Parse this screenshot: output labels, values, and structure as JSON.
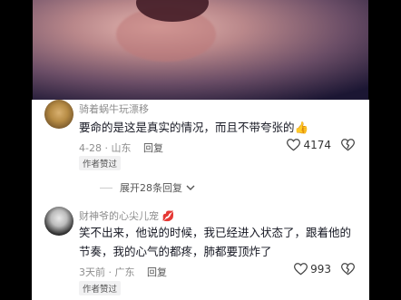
{
  "comments": [
    {
      "username": "骑着蜗牛玩漂移",
      "text": "要命的是这是真实的情况，而且不带夸张的",
      "emoji": "👍",
      "meta": "4-28 · 山东",
      "reply_label": "回复",
      "likes": "4174",
      "badge": "作者赞过"
    },
    {
      "username": "财神爷的心尖儿宠",
      "username_emoji": "💋",
      "text": "笑不出来，他说的时候，我已经进入状态了，跟着他的节奏，我的心气的都疼，肺都要顶炸了",
      "meta": "3天前 · 广东",
      "reply_label": "回复",
      "likes": "993",
      "badge": "作者赞过"
    }
  ],
  "expand_replies": "展开28条回复",
  "icons": {
    "like": "heart-outline-icon",
    "dislike": "broken-heart-icon",
    "expand": "chevron-down-icon"
  }
}
